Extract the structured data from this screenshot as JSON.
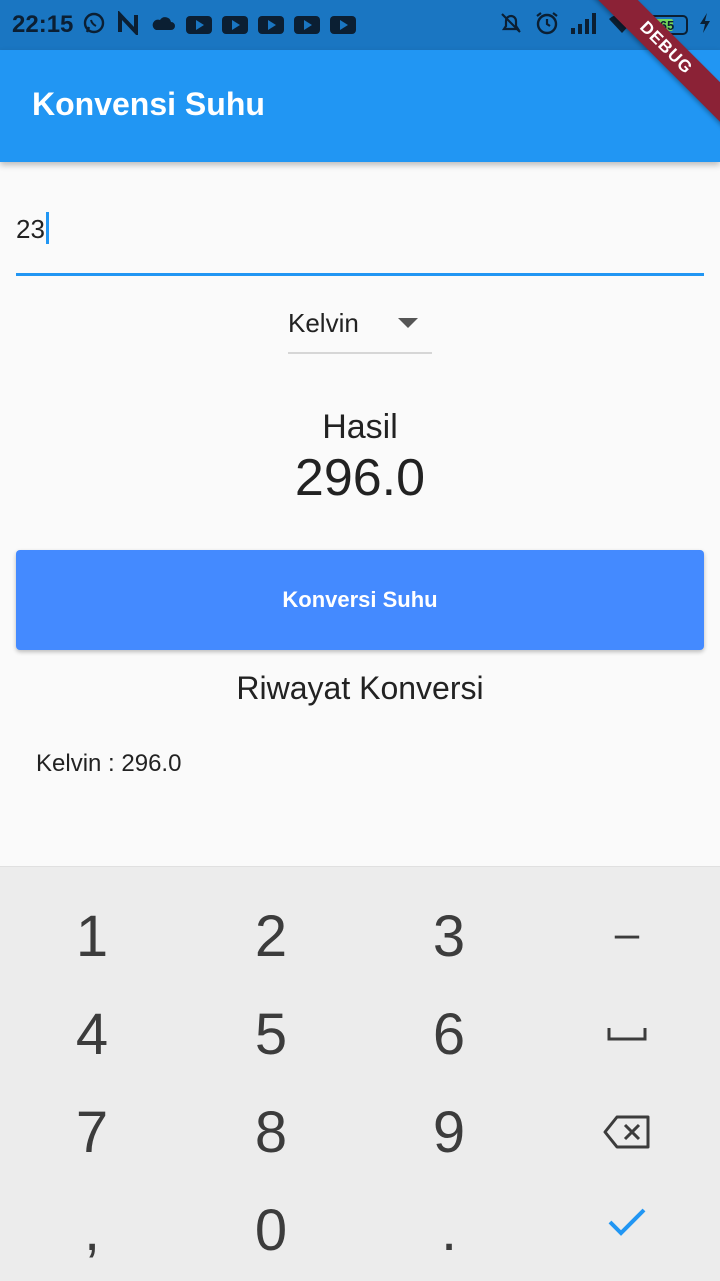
{
  "status_bar": {
    "time": "22:15",
    "battery": "65",
    "icons_left": [
      "whatsapp-icon",
      "n-icon",
      "cloud-icon",
      "youtube-icon",
      "youtube-icon",
      "youtube-icon",
      "youtube-icon",
      "youtube-icon"
    ],
    "icons_right": [
      "alarm-off-icon",
      "alarm-icon",
      "signal-icon",
      "wifi-icon",
      "battery-icon",
      "charging-icon"
    ]
  },
  "debug_banner": "DEBUG",
  "app_bar": {
    "title": "Konvensi Suhu"
  },
  "input": {
    "value": "23"
  },
  "dropdown": {
    "selected": "Kelvin"
  },
  "result": {
    "label": "Hasil",
    "value": "296.0"
  },
  "convert_button": {
    "label": "Konversi Suhu"
  },
  "history": {
    "title": "Riwayat Konversi",
    "items": [
      "Kelvin : 296.0"
    ]
  },
  "keyboard": {
    "keys": [
      "1",
      "2",
      "3",
      "–",
      "4",
      "5",
      "6",
      "space",
      "7",
      "8",
      "9",
      "backspace",
      ",",
      "0",
      ".",
      "done"
    ],
    "labels": {
      "1": "1",
      "2": "2",
      "3": "3",
      "minus": "–",
      "4": "4",
      "5": "5",
      "6": "6",
      "7": "7",
      "8": "8",
      "9": "9",
      "comma": ",",
      "0": "0",
      "dot": "."
    }
  },
  "colors": {
    "status_bar": "#1a76c2",
    "app_bar": "#2196f3",
    "button": "#448aff",
    "accent": "#2196f3",
    "debug": "#8b2236",
    "keyboard": "#ececec"
  }
}
